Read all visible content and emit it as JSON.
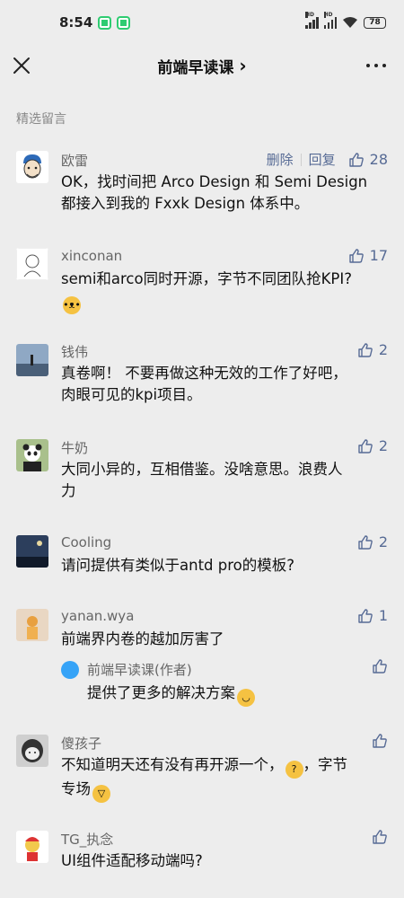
{
  "status_bar": {
    "time": "8:54",
    "battery": "78"
  },
  "nav": {
    "title": "前端早读课",
    "title_chevron": "›"
  },
  "section_label": "精选留言",
  "author_actions": {
    "delete": "删除",
    "reply": "回复"
  },
  "colors": {
    "link": "#576b95",
    "background": "#ededed"
  },
  "comments": [
    {
      "name": "欧雷",
      "likes": "28",
      "lines": [
        "OK，找时间把 Arco Design 和 Semi Design",
        "都接入到我的 Fxxk Design 体系中。"
      ]
    },
    {
      "name": "xinconan",
      "likes": "17",
      "lines": [
        "semi和arco同时开源，字节不同团队抢KPI?",
        ""
      ]
    },
    {
      "name": "钱伟",
      "likes": "2",
      "lines": [
        "真卷啊！ 不要再做这种无效的工作了好吧，",
        "肉眼可见的kpi项目。"
      ]
    },
    {
      "name": "牛奶",
      "likes": "2",
      "lines": [
        "大同小异的，互相借鉴。没啥意思。浪费人",
        "力"
      ]
    },
    {
      "name": "Cooling",
      "likes": "2",
      "lines": [
        "请问提供有类似于antd pro的模板?"
      ]
    },
    {
      "name": "yanan.wya",
      "likes": "1",
      "lines": [
        "前端界内卷的越加厉害了"
      ],
      "reply": {
        "name": "前端早读课(作者)",
        "text": "提供了更多的解决方案"
      }
    },
    {
      "name": "傻孩子",
      "likes": "",
      "lines": [
        "不知道明天还有没有再开源一个，",
        "专场"
      ],
      "line1_suffix": "，字节"
    },
    {
      "name": "TG_执念",
      "likes": "",
      "lines": [
        "UI组件适配移动端吗?"
      ]
    }
  ]
}
